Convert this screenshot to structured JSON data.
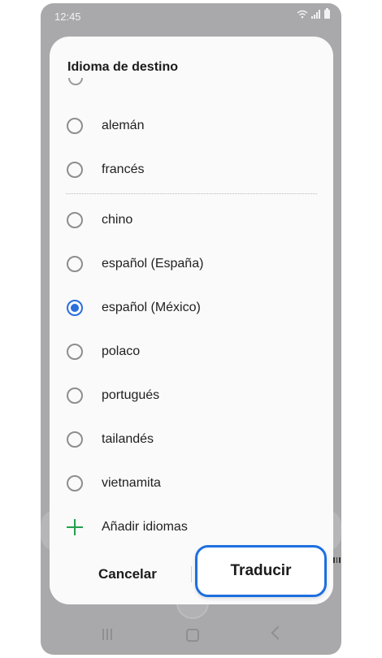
{
  "status_bar": {
    "time": "12:45"
  },
  "dialog": {
    "title": "Idioma de destino",
    "languages": [
      {
        "label": "alemán",
        "selected": false
      },
      {
        "label": "francés",
        "selected": false
      },
      {
        "label": "chino",
        "selected": false
      },
      {
        "label": "español (España)",
        "selected": false
      },
      {
        "label": "español (México)",
        "selected": true
      },
      {
        "label": "polaco",
        "selected": false
      },
      {
        "label": "portugués",
        "selected": false
      },
      {
        "label": "tailandés",
        "selected": false
      },
      {
        "label": "vietnamita",
        "selected": false
      }
    ],
    "add_languages_label": "Añadir idiomas",
    "cancel_label": "Cancelar",
    "translate_label": "Traducir"
  },
  "colors": {
    "accent": "#2a6fdb",
    "highlight_outline": "#1d6fe0",
    "add_icon": "#22a04b"
  }
}
